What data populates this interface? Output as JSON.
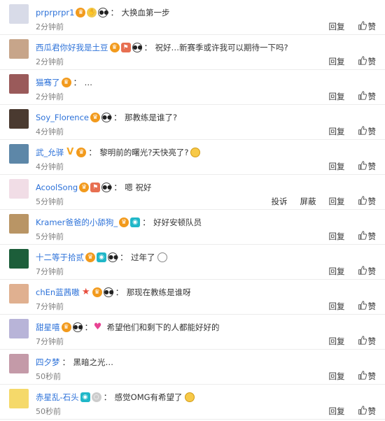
{
  "labels": {
    "reply": "回复",
    "like": "赞",
    "report": "投诉",
    "block": "屏蔽"
  },
  "comments": [
    {
      "user": "prprprpr1",
      "text": "大换血第一步",
      "time": "2分钟前",
      "avatar_color": "#d8dbe8",
      "badges": [
        "vip",
        "hand",
        "panda"
      ],
      "extra": ""
    },
    {
      "user": "西瓜君你好我是土豆",
      "text": "祝好…新赛季或许我可以期待一下吗?",
      "time": "2分钟前",
      "avatar_color": "#c7a58a",
      "badges": [
        "vip",
        "flag",
        "panda"
      ],
      "extra": ""
    },
    {
      "user": "猫骞了",
      "text": "…",
      "time": "2分钟前",
      "avatar_color": "#9a5a5a",
      "badges": [
        "vip"
      ],
      "extra": ""
    },
    {
      "user": "Soy_Florence",
      "text": "那教练是谁了?",
      "time": "4分钟前",
      "avatar_color": "#4a3a30",
      "badges": [
        "vip",
        "panda"
      ],
      "extra": ""
    },
    {
      "user": "武_允驿",
      "text": "黎明前的曙光?天快亮了?",
      "time": "4分钟前",
      "avatar_color": "#5d87a8",
      "badges": [
        "v",
        "vip"
      ],
      "extra": "cry"
    },
    {
      "user": "AcoolSong",
      "text": "嗯 祝好",
      "time": "5分钟前",
      "avatar_color": "#f1dde6",
      "badges": [
        "vip",
        "flag",
        "panda"
      ],
      "extra": "",
      "show_report": true
    },
    {
      "user": "Kramer爸爸的小舔狗_",
      "text": "好好安顿队员",
      "time": "5分钟前",
      "avatar_color": "#b99565",
      "badges": [
        "vip",
        "cam"
      ],
      "extra": ""
    },
    {
      "user": "十二等于拾贰",
      "text": "过年了",
      "time": "7分钟前",
      "avatar_color": "#1c5e3a",
      "badges": [
        "vip",
        "cam",
        "panda"
      ],
      "extra": "smile"
    },
    {
      "user": "chEn蓝茜嗷",
      "text": "那现在教练是谁呀",
      "time": "7分钟前",
      "avatar_color": "#e0b090",
      "badges": [
        "star",
        "vip",
        "panda"
      ],
      "extra": ""
    },
    {
      "user": "甜星嘻",
      "text": "希望他们和剩下的人都能好好的",
      "time": "7分钟前",
      "avatar_color": "#b8b4d8",
      "badges": [
        "vip",
        "panda"
      ],
      "extra": "",
      "prefix_heart": true
    },
    {
      "user": "四夕梦",
      "text": "黑暗之光…",
      "time": "50秒前",
      "avatar_color": "#c49aa8",
      "badges": [],
      "extra": ""
    },
    {
      "user": "赤星乱-石头",
      "text": "感觉OMG有希望了",
      "time": "50秒前",
      "avatar_color": "#f5d96a",
      "badges": [
        "cam",
        "ring"
      ],
      "extra": "grin"
    }
  ]
}
